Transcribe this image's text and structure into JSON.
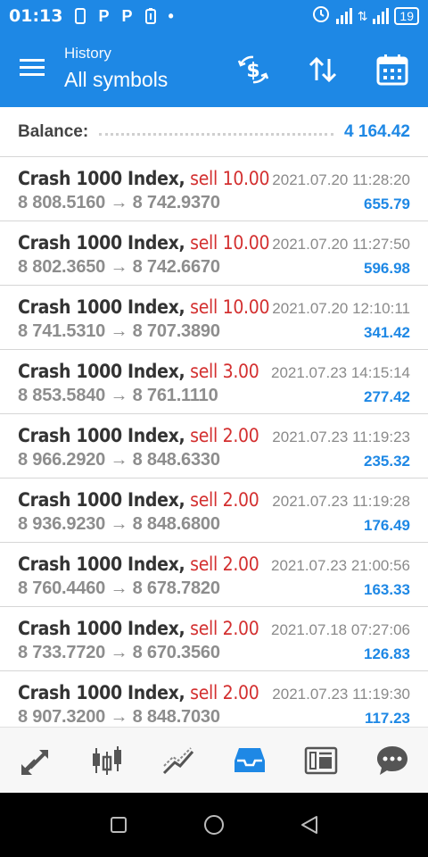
{
  "status_bar": {
    "time": "01:13",
    "icons": [
      "sim-icon",
      "parking-icon",
      "parking-icon",
      "battery-saver-icon",
      "dot-icon"
    ],
    "battery_level": "19"
  },
  "app_bar": {
    "subtitle": "History",
    "title": "All symbols",
    "actions": [
      "currency-exchange-icon",
      "sort-icon",
      "calendar-icon"
    ]
  },
  "balance": {
    "label": "Balance:",
    "value": "4 164.42"
  },
  "trades": [
    {
      "symbol": "Crash 1000 Index,",
      "side": "sell 10.00",
      "open": "8 808.5160",
      "close": "8 742.9370",
      "time": "2021.07.20 11:28:20",
      "profit": "655.79"
    },
    {
      "symbol": "Crash 1000 Index,",
      "side": "sell 10.00",
      "open": "8 802.3650",
      "close": "8 742.6670",
      "time": "2021.07.20 11:27:50",
      "profit": "596.98"
    },
    {
      "symbol": "Crash 1000 Index,",
      "side": "sell 10.00",
      "open": "8 741.5310",
      "close": "8 707.3890",
      "time": "2021.07.20 12:10:11",
      "profit": "341.42"
    },
    {
      "symbol": "Crash 1000 Index,",
      "side": "sell 3.00",
      "open": "8 853.5840",
      "close": "8 761.1110",
      "time": "2021.07.23 14:15:14",
      "profit": "277.42"
    },
    {
      "symbol": "Crash 1000 Index,",
      "side": "sell 2.00",
      "open": "8 966.2920",
      "close": "8 848.6330",
      "time": "2021.07.23 11:19:23",
      "profit": "235.32"
    },
    {
      "symbol": "Crash 1000 Index,",
      "side": "sell 2.00",
      "open": "8 936.9230",
      "close": "8 848.6800",
      "time": "2021.07.23 11:19:28",
      "profit": "176.49"
    },
    {
      "symbol": "Crash 1000 Index,",
      "side": "sell 2.00",
      "open": "8 760.4460",
      "close": "8 678.7820",
      "time": "2021.07.23 21:00:56",
      "profit": "163.33"
    },
    {
      "symbol": "Crash 1000 Index,",
      "side": "sell 2.00",
      "open": "8 733.7720",
      "close": "8 670.3560",
      "time": "2021.07.18 07:27:06",
      "profit": "126.83"
    },
    {
      "symbol": "Crash 1000 Index,",
      "side": "sell 2.00",
      "open": "8 907.3200",
      "close": "8 848.7030",
      "time": "2021.07.23 11:19:30",
      "profit": "117.23"
    }
  ],
  "arrow": "→",
  "bottom_nav": {
    "items": [
      "quotes-icon",
      "chart-candles-icon",
      "trade-icon",
      "history-icon",
      "news-icon",
      "chat-icon"
    ],
    "active": "history-icon",
    "active_color": "#1e88e5",
    "inactive_color": "#555555"
  },
  "colors": {
    "primary": "#1e88e5",
    "sell": "#d32f2f",
    "price": "#8d8d8d"
  }
}
